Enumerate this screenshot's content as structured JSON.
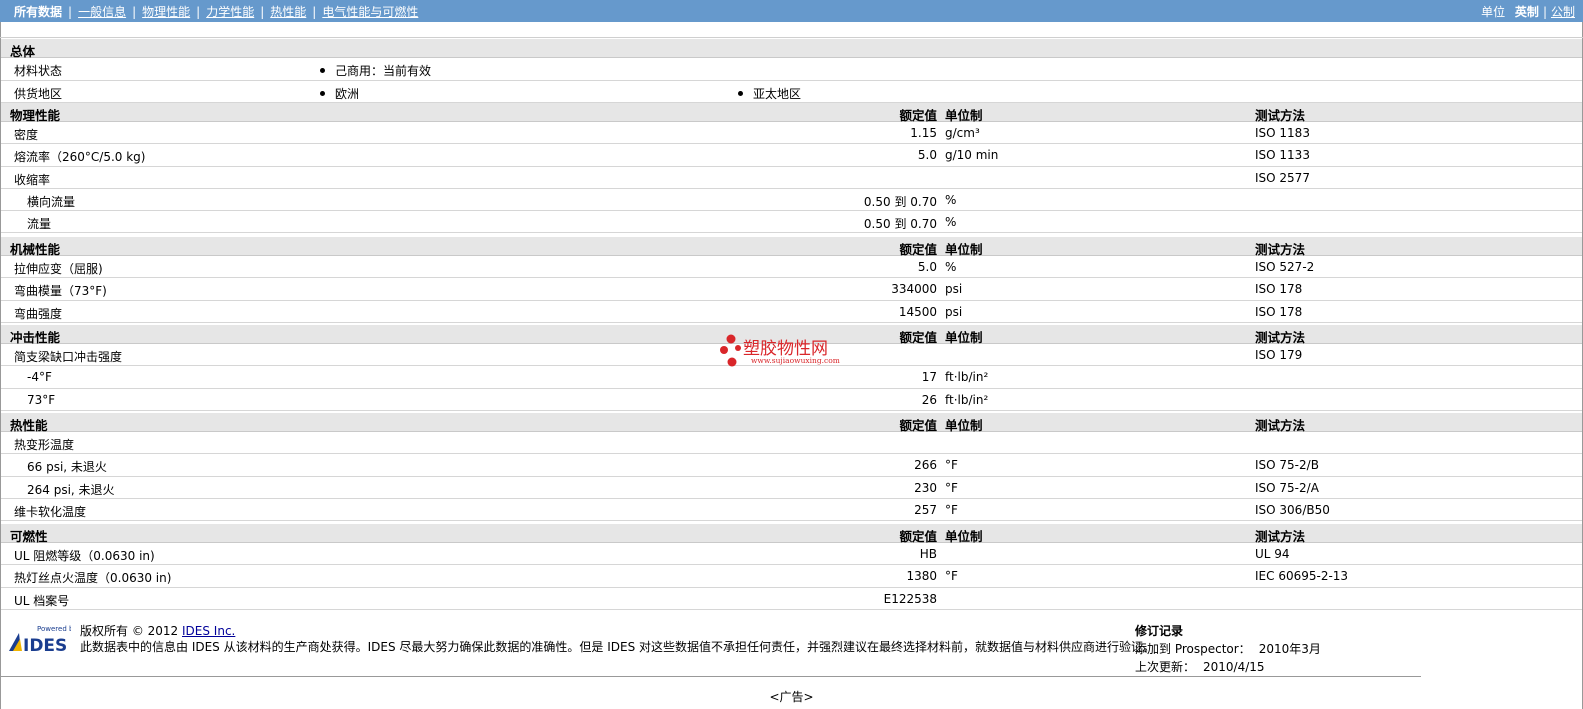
{
  "nav": {
    "items": [
      {
        "label": "所有数据",
        "active": true
      },
      {
        "label": "一般信息"
      },
      {
        "label": "物理性能"
      },
      {
        "label": "力学性能"
      },
      {
        "label": "热性能"
      },
      {
        "label": "电气性能与可燃性"
      }
    ]
  },
  "units": {
    "label": "单位",
    "english": "英制",
    "metric": "公制"
  },
  "general": {
    "title": "总体",
    "material_status_label": "材料状态",
    "material_status_value": "己商用：当前有效",
    "supply_region_label": "供货地区",
    "region_1": "欧洲",
    "region_2": "亚太地区"
  },
  "headers": {
    "nominal": "额定值",
    "unit": "单位制",
    "test": "测试方法"
  },
  "physical": {
    "title": "物理性能",
    "rows": [
      {
        "name": "密度",
        "value": "1.15",
        "unit": "g/cm³",
        "test": "ISO 1183"
      },
      {
        "name": "熔流率（260°C/5.0 kg)",
        "value": "5.0",
        "unit": "g/10 min",
        "test": "ISO 1133"
      },
      {
        "name": "收缩率",
        "value": "",
        "unit": "",
        "test": "ISO 2577"
      },
      {
        "name": "横向流量",
        "value": "0.50 到  0.70",
        "unit": "%",
        "test": "",
        "sub": true
      },
      {
        "name": "流量",
        "value": "0.50 到  0.70",
        "unit": "%",
        "test": "",
        "sub": true
      }
    ]
  },
  "mechanical": {
    "title": "机械性能",
    "rows": [
      {
        "name": "拉伸应变（屈服)",
        "value": "5.0",
        "unit": "%",
        "test": "ISO 527-2"
      },
      {
        "name": "弯曲模量（73°F)",
        "value": "334000",
        "unit": "psi",
        "test": "ISO 178"
      },
      {
        "name": "弯曲强度",
        "value": "14500",
        "unit": "psi",
        "test": "ISO 178"
      }
    ]
  },
  "impact": {
    "title": "冲击性能",
    "rows": [
      {
        "name": "简支梁缺口冲击强度",
        "value": "",
        "unit": "",
        "test": "ISO 179"
      },
      {
        "name": "-4°F",
        "value": "17",
        "unit": "ft·lb/in²",
        "test": "",
        "sub": true
      },
      {
        "name": "73°F",
        "value": "26",
        "unit": "ft·lb/in²",
        "test": "",
        "sub": true
      }
    ]
  },
  "thermal": {
    "title": "热性能",
    "rows": [
      {
        "name": "热变形温度",
        "value": "",
        "unit": "",
        "test": ""
      },
      {
        "name": "66 psi, 未退火",
        "value": "266",
        "unit": "°F",
        "test": "ISO 75-2/B",
        "sub": true
      },
      {
        "name": "264 psi, 未退火",
        "value": "230",
        "unit": "°F",
        "test": "ISO 75-2/A",
        "sub": true
      },
      {
        "name": "维卡软化温度",
        "value": "257",
        "unit": "°F",
        "test": "ISO 306/B50"
      }
    ]
  },
  "flammability": {
    "title": "可燃性",
    "rows": [
      {
        "name": "UL 阻燃等级（0.0630 in)",
        "value": "HB",
        "unit": "",
        "test": "UL 94"
      },
      {
        "name": "热灯丝点火温度（0.0630 in)",
        "value": "1380",
        "unit": "°F",
        "test": "IEC 60695-2-13"
      },
      {
        "name": "UL 档案号",
        "value": "E122538",
        "unit": "",
        "test": ""
      }
    ]
  },
  "footer": {
    "logo_powered": "Powered by",
    "logo_name": "IDES",
    "copyright_prefix": "版权所有  © 2012",
    "copyright_link": "IDES Inc.",
    "disclaimer": "此数据表中的信息由  IDES 从该材料的生产商处获得。IDES 尽最大努力确保此数据的准确性。但是  IDES 对这些数据值不承担任何责任，并强烈建议在最终选择材料前，就数据值与材料供应商进行验证。",
    "revision_title": "修订记录",
    "added_label": "添加到  Prospector：",
    "added_value": "2010年3月",
    "updated_label": "上次更新：",
    "updated_value": "2010/4/15"
  },
  "ad": "<广告>",
  "watermark": {
    "text": "塑胶物性网",
    "url": "www.sujiaowuxing.com"
  },
  "colors": {
    "topbar": "#6699cc",
    "header_row": "#e6e6e6",
    "watermark": "#d9262a"
  }
}
